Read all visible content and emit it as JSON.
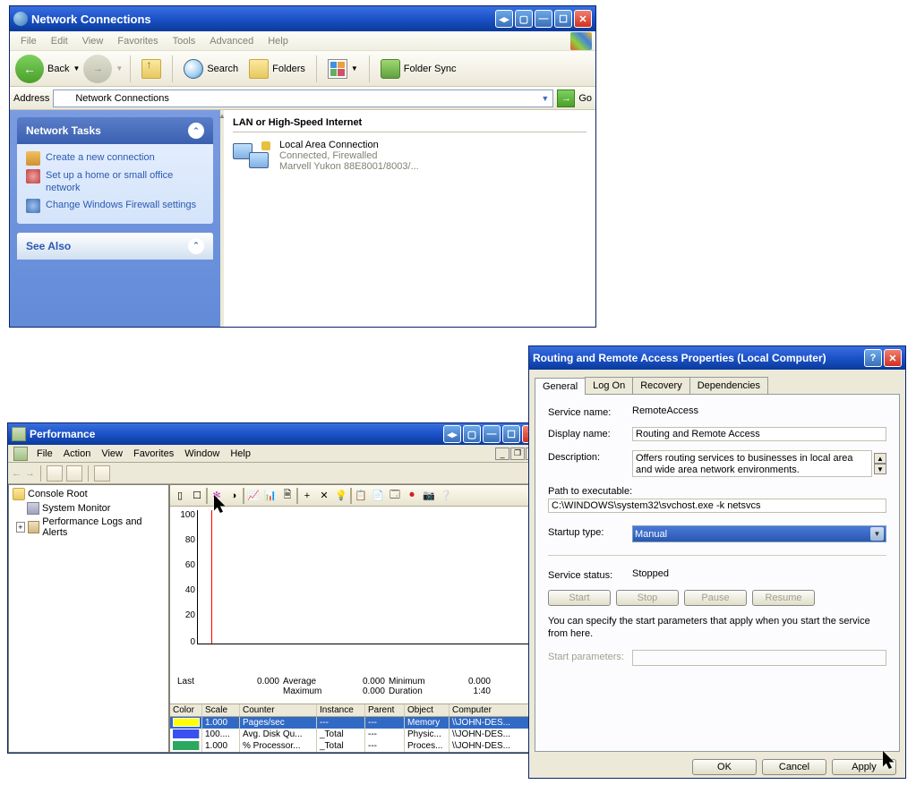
{
  "win_nc": {
    "title": "Network Connections",
    "menu": [
      "File",
      "Edit",
      "View",
      "Favorites",
      "Tools",
      "Advanced",
      "Help"
    ],
    "toolbar": {
      "back": "Back",
      "search": "Search",
      "folders": "Folders",
      "sync": "Folder Sync"
    },
    "address": {
      "label": "Address",
      "value": "Network Connections",
      "go": "Go"
    },
    "tasks_title": "Network Tasks",
    "tasks": [
      "Create a new connection",
      "Set up a home or small office network",
      "Change Windows Firewall settings"
    ],
    "seealso_title": "See Also",
    "section": "LAN or High-Speed Internet",
    "conn": {
      "name": "Local Area Connection",
      "status": "Connected, Firewalled",
      "device": "Marvell Yukon 88E8001/8003/..."
    }
  },
  "win_perf": {
    "title": "Performance",
    "menu": [
      "File",
      "Action",
      "View",
      "Favorites",
      "Window",
      "Help"
    ],
    "tree": [
      "Console Root",
      "System Monitor",
      "Performance Logs and Alerts"
    ],
    "chart_data": {
      "type": "line",
      "ylim": [
        0,
        100
      ],
      "yticks": [
        0,
        20,
        40,
        60,
        80,
        100
      ],
      "stats": {
        "last": "0.000",
        "average": "0.000",
        "minimum": "0.000",
        "maximum": "0.000",
        "duration": "1:40"
      },
      "stat_labels": {
        "last": "Last",
        "average": "Average",
        "minimum": "Minimum",
        "maximum": "Maximum",
        "duration": "Duration"
      },
      "columns": [
        "Color",
        "Scale",
        "Counter",
        "Instance",
        "Parent",
        "Object",
        "Computer"
      ],
      "series": [
        {
          "color": "#ffff00",
          "scale": "1.000",
          "counter": "Pages/sec",
          "instance": "---",
          "parent": "---",
          "object": "Memory",
          "computer": "\\\\JOHN-DES..."
        },
        {
          "color": "#3a50f0",
          "scale": "100....",
          "counter": "Avg. Disk Qu...",
          "instance": "_Total",
          "parent": "---",
          "object": "Physic...",
          "computer": "\\\\JOHN-DES..."
        },
        {
          "color": "#2aa860",
          "scale": "1.000",
          "counter": "% Processor...",
          "instance": "_Total",
          "parent": "---",
          "object": "Proces...",
          "computer": "\\\\JOHN-DES..."
        }
      ]
    }
  },
  "win_svc": {
    "title": "Routing and Remote Access Properties (Local Computer)",
    "tabs": [
      "General",
      "Log On",
      "Recovery",
      "Dependencies"
    ],
    "labels": {
      "service_name": "Service name:",
      "display_name": "Display name:",
      "description": "Description:",
      "path": "Path to executable:",
      "startup": "Startup type:",
      "status": "Service status:",
      "start_params": "Start parameters:"
    },
    "service_name": "RemoteAccess",
    "display_name": "Routing and Remote Access",
    "description": "Offers routing services to businesses in local area and wide area network environments.",
    "path": "C:\\WINDOWS\\system32\\svchost.exe -k netsvcs",
    "startup": "Manual",
    "status": "Stopped",
    "buttons": {
      "start": "Start",
      "stop": "Stop",
      "pause": "Pause",
      "resume": "Resume"
    },
    "hint": "You can specify the start parameters that apply when you start the service from here.",
    "footer": {
      "ok": "OK",
      "cancel": "Cancel",
      "apply": "Apply"
    }
  }
}
